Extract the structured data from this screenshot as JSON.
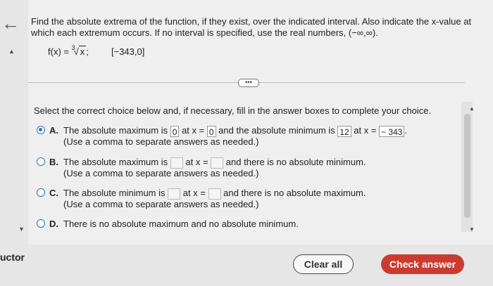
{
  "nav": {
    "back_glyph": "←",
    "collapse_up": "▲",
    "collapse_down": "▼"
  },
  "question": {
    "text": "Find the absolute extrema of the function, if they exist, over the indicated interval. Also indicate the x-value at which each extremum occurs. If no interval is specified, use the real numbers, (−∞,∞).",
    "function_prefix": "f(x) = ",
    "root_index": "3",
    "radicand": "x",
    "function_suffix": ";",
    "interval": "[−343,0]"
  },
  "more_label": "•••",
  "instruction": "Select the correct choice below and, if necessary, fill in the answer boxes to complete your choice.",
  "choices": [
    {
      "letter": "A.",
      "selected": true,
      "p1": "The absolute maximum is",
      "v1": "0",
      "p2": "at x =",
      "v2": "0",
      "p3": "and the absolute minimum is",
      "v3": "12",
      "p4": "at x =",
      "v4": "− 343",
      "p5": ".",
      "note": "(Use a comma to separate answers as needed.)"
    },
    {
      "letter": "B.",
      "selected": false,
      "p1": "The absolute maximum is",
      "p2": "at x =",
      "p3": "and there is no absolute minimum.",
      "note": "(Use a comma to separate answers as needed.)"
    },
    {
      "letter": "C.",
      "selected": false,
      "p1": "The absolute minimum is",
      "p2": "at x =",
      "p3": "and there is no absolute maximum.",
      "note": "(Use a comma to separate answers as needed.)"
    },
    {
      "letter": "D.",
      "selected": false,
      "p1": "There is no absolute maximum and no absolute minimum."
    }
  ],
  "footer": {
    "instructor_label": "uctor",
    "clear_label": "Clear all",
    "check_label": "Check answer"
  },
  "colors": {
    "accent": "#2a73b8",
    "check_button": "#cc3b2f"
  }
}
